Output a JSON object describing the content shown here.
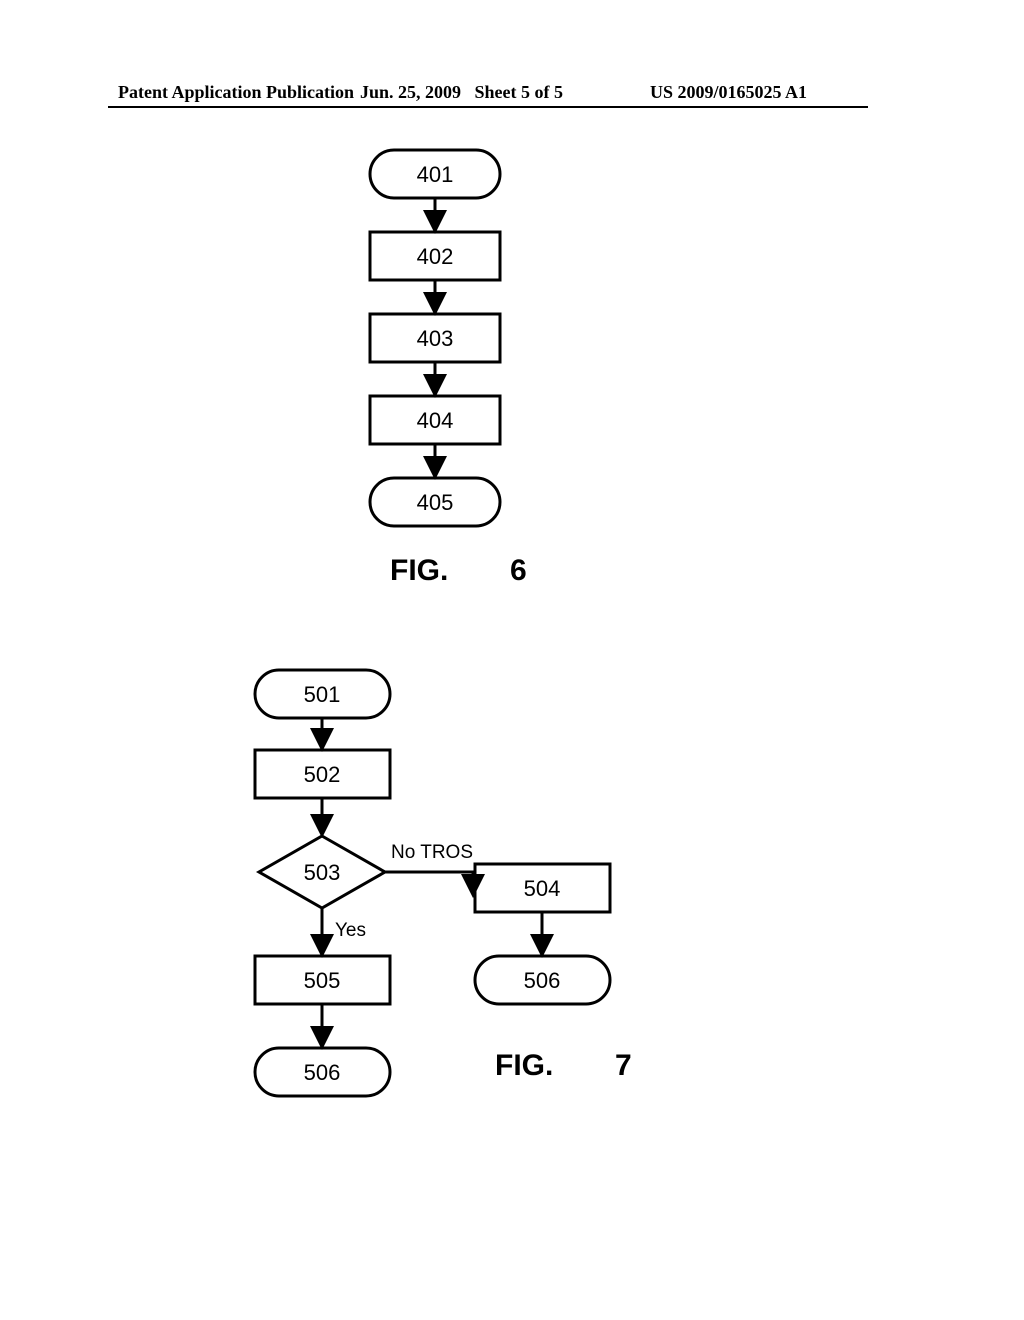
{
  "header": {
    "left": "Patent Application Publication",
    "mid": "Jun. 25, 2009   Sheet 5 of 5",
    "right": "US 2009/0165025 A1"
  },
  "fig6": {
    "label_fig": "FIG.",
    "label_num": "6",
    "nodes": {
      "n401": "401",
      "n402": "402",
      "n403": "403",
      "n404": "404",
      "n405": "405"
    }
  },
  "fig7": {
    "label_fig": "FIG.",
    "label_num": "7",
    "nodes": {
      "n501": "501",
      "n502": "502",
      "n503": "503",
      "n504": "504",
      "n505": "505",
      "n506a": "506",
      "n506b": "506"
    },
    "edges": {
      "no_tros": "No TROS",
      "yes": "Yes"
    }
  }
}
